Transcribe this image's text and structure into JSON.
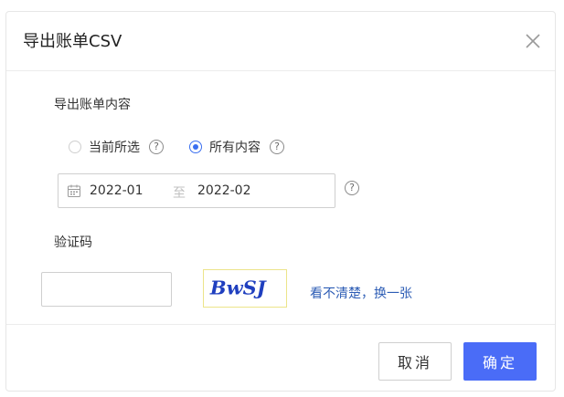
{
  "dialog": {
    "title": "导出账单CSV",
    "close_icon": "close-icon"
  },
  "content_section": {
    "label": "导出账单内容",
    "options": [
      {
        "label": "当前所选",
        "checked": false
      },
      {
        "label": "所有内容",
        "checked": true
      }
    ]
  },
  "date_range": {
    "start": "2022-01",
    "separator": "至",
    "end": "2022-02",
    "icon": "calendar-icon"
  },
  "captcha": {
    "label": "验证码",
    "input_value": "",
    "image_text": "BwSJ",
    "refresh_label": "看不清楚，换一张"
  },
  "buttons": {
    "cancel": "取消",
    "confirm": "确定"
  },
  "colors": {
    "accent": "#4a6cf7",
    "link": "#2d5db5",
    "radio_checked": "#3a6ff0"
  }
}
